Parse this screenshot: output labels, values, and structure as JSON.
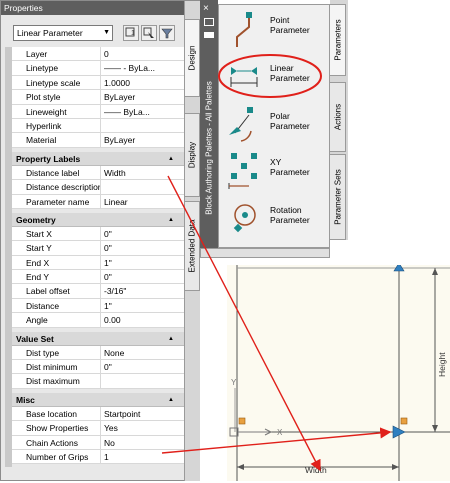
{
  "properties": {
    "title": "Properties",
    "close_label": "×",
    "selected_type": "Linear Parameter",
    "tabs": [
      "Design",
      "Display",
      "Extended Data"
    ],
    "general_rows": [
      {
        "key": "Layer",
        "value": "0"
      },
      {
        "key": "Linetype",
        "value": "—— - ByLa..."
      },
      {
        "key": "Linetype scale",
        "value": "1.0000"
      },
      {
        "key": "Plot style",
        "value": "ByLayer"
      },
      {
        "key": "Lineweight",
        "value": "—— ByLa..."
      },
      {
        "key": "Hyperlink",
        "value": ""
      },
      {
        "key": "Material",
        "value": "ByLayer"
      }
    ],
    "sections": [
      {
        "title": "Property Labels",
        "rows": [
          {
            "key": "Distance label",
            "value": "Width"
          },
          {
            "key": "Distance description",
            "value": ""
          },
          {
            "key": "Parameter name",
            "value": "Linear"
          }
        ]
      },
      {
        "title": "Geometry",
        "rows": [
          {
            "key": "Start X",
            "value": "0\""
          },
          {
            "key": "Start Y",
            "value": "0\""
          },
          {
            "key": "End X",
            "value": "1\""
          },
          {
            "key": "End Y",
            "value": "0\""
          },
          {
            "key": "Label offset",
            "value": "-3/16\""
          },
          {
            "key": "Distance",
            "value": "1\""
          },
          {
            "key": "Angle",
            "value": "0.00"
          }
        ]
      },
      {
        "title": "Value Set",
        "rows": [
          {
            "key": "Dist type",
            "value": "None"
          },
          {
            "key": "Dist minimum",
            "value": "0\""
          },
          {
            "key": "Dist maximum",
            "value": ""
          }
        ]
      },
      {
        "title": "Misc",
        "rows": [
          {
            "key": "Base location",
            "value": "Startpoint"
          },
          {
            "key": "Show Properties",
            "value": "Yes"
          },
          {
            "key": "Chain Actions",
            "value": "No"
          },
          {
            "key": "Number of Grips",
            "value": "1"
          }
        ]
      }
    ]
  },
  "palette": {
    "title": "Block Authoring Palettes - All Palettes",
    "close_label": "×",
    "tabs": [
      "Parameters",
      "Actions",
      "Parameter Sets"
    ],
    "tools": [
      {
        "label": "Point Parameter",
        "icon": "point-parameter-icon"
      },
      {
        "label": "Linear Parameter",
        "icon": "linear-parameter-icon"
      },
      {
        "label": "Polar Parameter",
        "icon": "polar-parameter-icon"
      },
      {
        "label": "XY Parameter",
        "icon": "xy-parameter-icon"
      },
      {
        "label": "Rotation Parameter",
        "icon": "rotation-parameter-icon"
      }
    ]
  },
  "drawing": {
    "height_label": "Height",
    "width_label": "Width",
    "ucs_x": "X",
    "ucs_y": "Y"
  },
  "colors": {
    "callout_red": "#e0201a",
    "grip_blue": "#2f7fc0",
    "titlebar": "#5e5e5e",
    "drawing_bg": "#fcfaf0"
  }
}
